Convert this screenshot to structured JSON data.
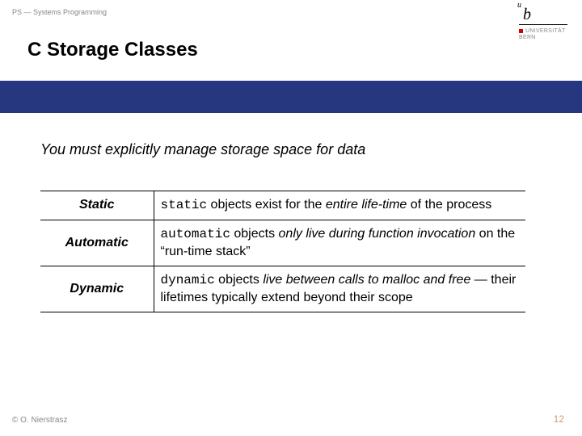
{
  "header": {
    "course": "PS — Systems Programming",
    "title": "C Storage Classes"
  },
  "logo": {
    "letter": "b",
    "sup": "u",
    "line1": "UNIVERSITÄT",
    "line2": "BERN"
  },
  "content": {
    "lead": "You must explicitly manage storage space for data",
    "rows": [
      {
        "label": "Static",
        "mono": "static",
        "mid": " objects exist for the ",
        "ital": "entire life-time",
        "tail": " of the process"
      },
      {
        "label": "Automatic",
        "mono": "automatic",
        "mid": " objects ",
        "ital": "only live during function invocation",
        "tail": " on the “run-time stack”"
      },
      {
        "label": "Dynamic",
        "mono": "dynamic",
        "mid": " objects ",
        "ital": "live between calls to malloc and free",
        "tail": " — their lifetimes typically extend beyond their scope"
      }
    ]
  },
  "footer": {
    "copyright": "© O. Nierstrasz",
    "page": "12"
  }
}
